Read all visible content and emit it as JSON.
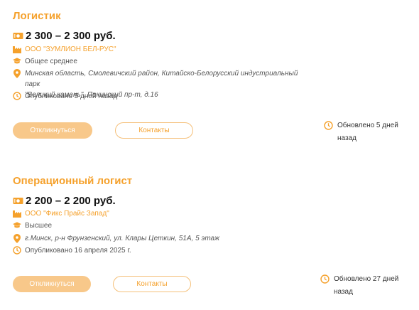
{
  "vacancies": [
    {
      "title": "Логистик",
      "salary": "2 300 – 2 300 руб.",
      "company": "ООО \"ЗУМЛИОН БЕЛ-РУС\"",
      "education": "Общее среднее",
      "address_line1": "Минская область, Смолевичский район, Китайско-Белорусский индустриальный парк",
      "address_line2": "\"Великий камень\", Пекинский пр-т, д.16",
      "published": "Опубликовано 5 дней назад",
      "apply_label": "Откликнуться",
      "contacts_label": "Контакты",
      "updated": "Обновлено 5 дней назад"
    },
    {
      "title": "Операционный логист",
      "salary": "2 200 – 2 200 руб.",
      "company": "ООО \"Фикс Прайс Запад\"",
      "education": "Высшее",
      "address_line1": "г.Минск, р-н Фрунзенский, ул. Клары Цеткин, 51А, 5 этаж",
      "address_line2": "",
      "published": "Опубликовано 16 апреля 2025 г.",
      "apply_label": "Откликнуться",
      "contacts_label": "Контакты",
      "updated": "Обновлено 27 дней назад"
    }
  ],
  "icons": [
    "money-icon",
    "company-icon",
    "education-icon",
    "location-icon",
    "clock-icon"
  ],
  "colors": {
    "accent": "#f5a12c",
    "button_fill": "#f8c88a",
    "text": "#333333"
  }
}
